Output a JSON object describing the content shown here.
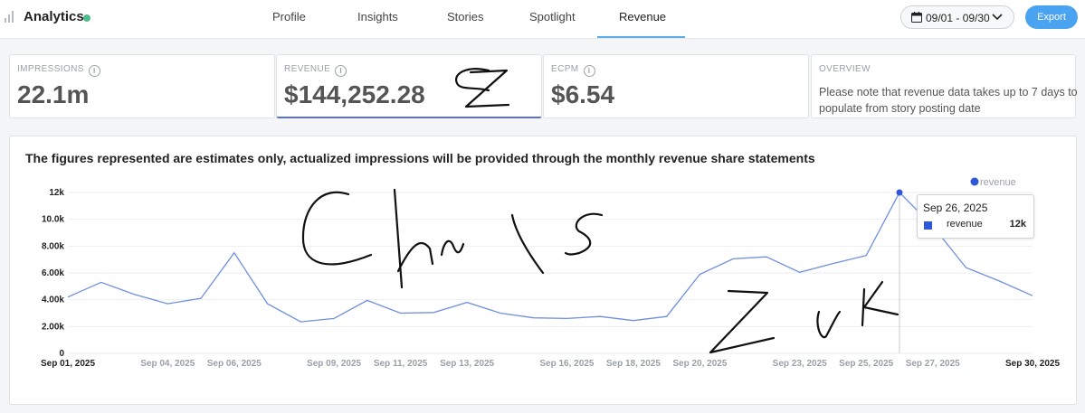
{
  "app": {
    "title": "Analytics"
  },
  "nav": {
    "tabs": [
      {
        "label": "Profile"
      },
      {
        "label": "Insights"
      },
      {
        "label": "Stories"
      },
      {
        "label": "Spotlight"
      },
      {
        "label": "Revenue",
        "active": true
      }
    ]
  },
  "header": {
    "date_range": "09/01 - 09/30",
    "export_label": "Export"
  },
  "metrics": [
    {
      "label": "IMPRESSIONS",
      "value": "22.1m"
    },
    {
      "label": "REVENUE",
      "value": "$144,252.28",
      "selected": true
    },
    {
      "label": "ECPM",
      "value": "$6.54"
    },
    {
      "label": "OVERVIEW",
      "note": "Please note that revenue data takes up to 7 days to populate from story posting date"
    }
  ],
  "chart_heading": "The figures represented are estimates only, actualized impressions will be provided through the monthly revenue share statements",
  "tooltip": {
    "date": "Sep 26, 2025",
    "series": "revenue",
    "value": "12k"
  },
  "colors": {
    "accent": "#4aa3f0",
    "series": "#2e57d9",
    "status": "#4cbb8a"
  },
  "chart_data": {
    "type": "line",
    "series": [
      {
        "name": "revenue",
        "x": [
          "Sep 01, 2025",
          "Sep 02, 2025",
          "Sep 03, 2025",
          "Sep 04, 2025",
          "Sep 05, 2025",
          "Sep 06, 2025",
          "Sep 07, 2025",
          "Sep 08, 2025",
          "Sep 09, 2025",
          "Sep 10, 2025",
          "Sep 11, 2025",
          "Sep 12, 2025",
          "Sep 13, 2025",
          "Sep 14, 2025",
          "Sep 15, 2025",
          "Sep 16, 2025",
          "Sep 17, 2025",
          "Sep 18, 2025",
          "Sep 19, 2025",
          "Sep 20, 2025",
          "Sep 21, 2025",
          "Sep 22, 2025",
          "Sep 23, 2025",
          "Sep 24, 2025",
          "Sep 25, 2025",
          "Sep 26, 2025",
          "Sep 27, 2025",
          "Sep 28, 2025",
          "Sep 29, 2025",
          "Sep 30, 2025"
        ],
        "values": [
          4200,
          5300,
          4400,
          3700,
          4100,
          7500,
          3700,
          2350,
          2600,
          3950,
          3000,
          3050,
          3800,
          3000,
          2650,
          2600,
          2750,
          2450,
          2750,
          5900,
          7050,
          7200,
          6050,
          6700,
          7300,
          12000,
          9500,
          6400,
          5400,
          4300
        ]
      }
    ],
    "legend": [
      "revenue"
    ],
    "legend_position": "top-right",
    "y_ticks": [
      "0",
      "2.00k",
      "4.00k",
      "6.00k",
      "8.00k",
      "10.0k",
      "12k"
    ],
    "x_ticks": [
      "Sep 01, 2025",
      "Sep 04, 2025",
      "Sep 06, 2025",
      "Sep 09, 2025",
      "Sep 11, 2025",
      "Sep 13, 2025",
      "Sep 16, 2025",
      "Sep 18, 2025",
      "Sep 20, 2025",
      "Sep 23, 2025",
      "Sep 25, 2025",
      "Sep 27, 2025",
      "Sep 30, 2025"
    ],
    "ylim": [
      0,
      12000
    ],
    "grid": true,
    "highlight": "Sep 26, 2025"
  }
}
